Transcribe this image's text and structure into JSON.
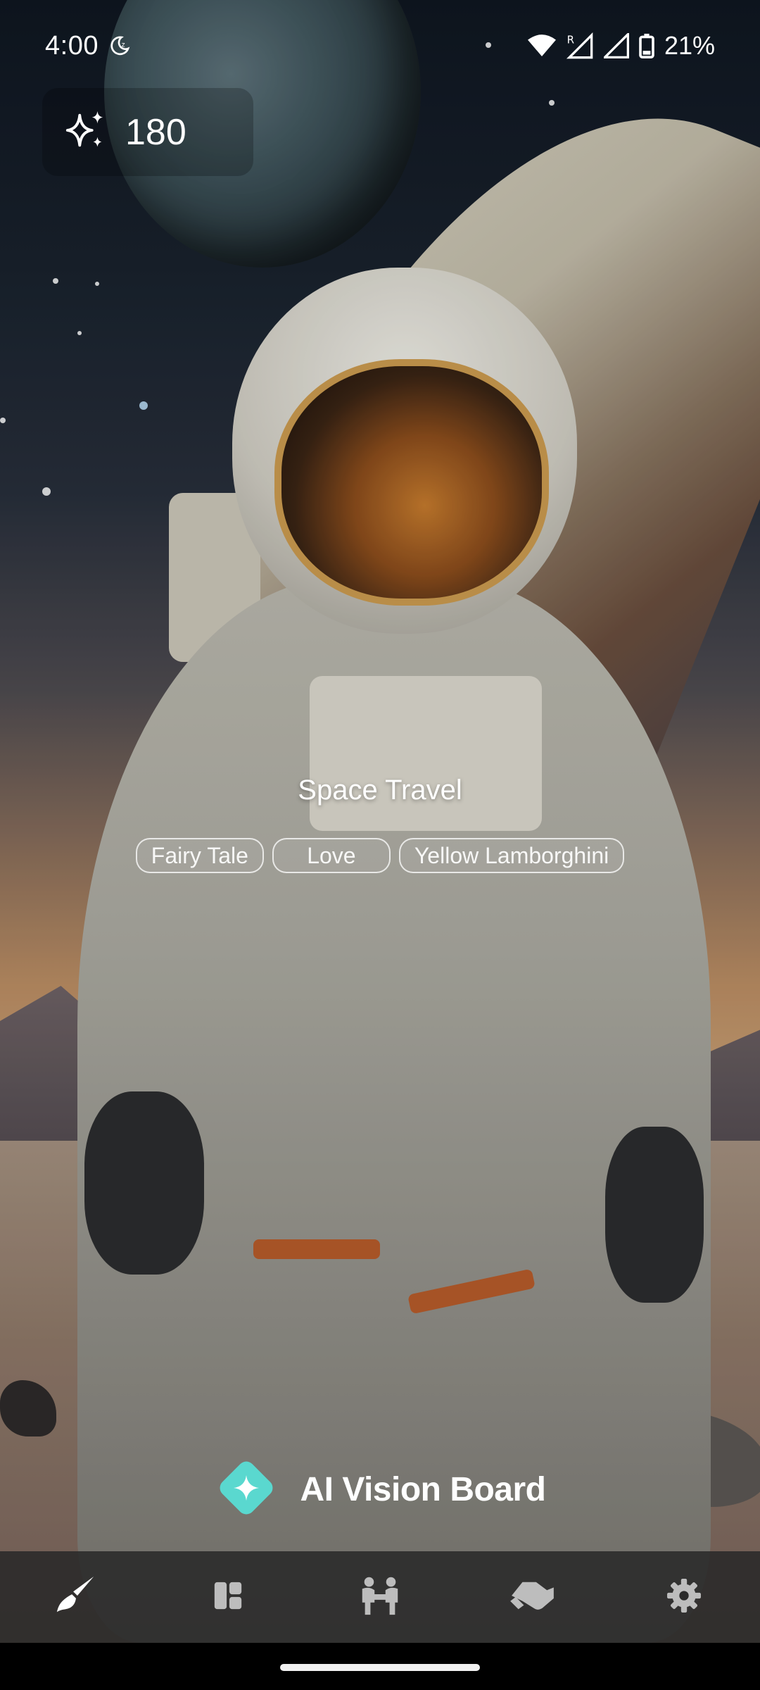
{
  "status_bar": {
    "time": "4:00",
    "battery_percent": "21%",
    "icons": [
      "do-not-disturb-moon-icon",
      "wifi-icon",
      "signal-roaming-icon",
      "signal-icon",
      "battery-icon"
    ]
  },
  "credits": {
    "icon": "sparkles-icon",
    "value": "180"
  },
  "theme": {
    "title": "Space Travel",
    "tags": [
      "Fairy Tale",
      "Love",
      "Yellow Lamborghini"
    ]
  },
  "brand": {
    "logo_icon": "diamond-logo-icon",
    "name": "AI Vision Board",
    "accent_color": "#5ad8cf"
  },
  "bottom_nav": {
    "items": [
      {
        "icon": "paintbrush-icon",
        "active": true
      },
      {
        "icon": "dashboard-icon",
        "active": false
      },
      {
        "icon": "group-people-icon",
        "active": false
      },
      {
        "icon": "handshake-icon",
        "active": false
      },
      {
        "icon": "gear-icon",
        "active": false
      }
    ],
    "active_color": "#ffffff",
    "inactive_color": "#bdbdbd"
  }
}
